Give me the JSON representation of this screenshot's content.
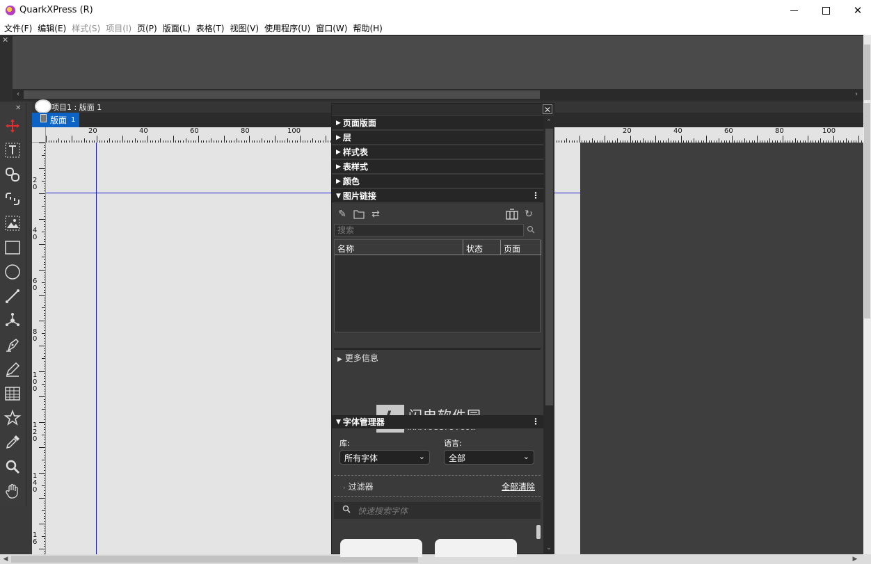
{
  "window": {
    "title": "QuarkXPress (R)",
    "minimize_glyph": "—",
    "close_glyph": "✕"
  },
  "menu": [
    {
      "label": "文件(F)",
      "enabled": true
    },
    {
      "label": "编辑(E)",
      "enabled": true
    },
    {
      "label": "样式(S)",
      "enabled": false
    },
    {
      "label": "项目(I)",
      "enabled": false
    },
    {
      "label": "页(P)",
      "enabled": true
    },
    {
      "label": "版面(L)",
      "enabled": true
    },
    {
      "label": "表格(T)",
      "enabled": true
    },
    {
      "label": "视图(V)",
      "enabled": true
    },
    {
      "label": "使用程序(U)",
      "enabled": true
    },
    {
      "label": "窗口(W)",
      "enabled": true
    },
    {
      "label": "帮助(H)",
      "enabled": true
    }
  ],
  "tools": [
    "move-icon",
    "text-box-icon",
    "text-link-icon",
    "text-unlink-icon",
    "picture-box-icon",
    "rectangle-icon",
    "oval-icon",
    "line-icon",
    "bezier-icon",
    "pen-icon",
    "pencil-icon",
    "table-icon",
    "star-icon",
    "eyedropper-icon",
    "zoom-icon",
    "hand-icon"
  ],
  "layout": {
    "document_title": "项目1 : 版面 1",
    "tab_label": "版面",
    "tab_number": "1"
  },
  "ruler": {
    "h_labels": [
      "20",
      "40",
      "60",
      "80",
      "100",
      "20",
      "40",
      "60",
      "80",
      "100"
    ],
    "v_labels": [
      "2\n0",
      "4\n0",
      "6\n0",
      "8\n0",
      "1\n0\n0",
      "1\n2\n0",
      "1\n4\n0",
      "1\n6"
    ]
  },
  "palette": {
    "sections": [
      {
        "label": "页面版面",
        "expanded": false
      },
      {
        "label": "层",
        "expanded": false
      },
      {
        "label": "样式表",
        "expanded": false
      },
      {
        "label": "表样式",
        "expanded": false
      },
      {
        "label": "颜色",
        "expanded": false
      },
      {
        "label": "图片链接",
        "expanded": true
      }
    ],
    "picture_links": {
      "search_placeholder": "搜索",
      "columns": [
        "名称",
        "状态",
        "页面"
      ],
      "more_info": "更多信息"
    },
    "watermark": {
      "title": "闪电软件园",
      "url": "www.sd173.com"
    },
    "font_manager": {
      "title": "字体管理器",
      "library_label": "库:",
      "library_value": "所有字体",
      "language_label": "语言:",
      "language_value": "全部",
      "filter_label": "过滤器",
      "clear_all": "全部清除",
      "quick_search_placeholder": "快速搜索字体"
    }
  }
}
